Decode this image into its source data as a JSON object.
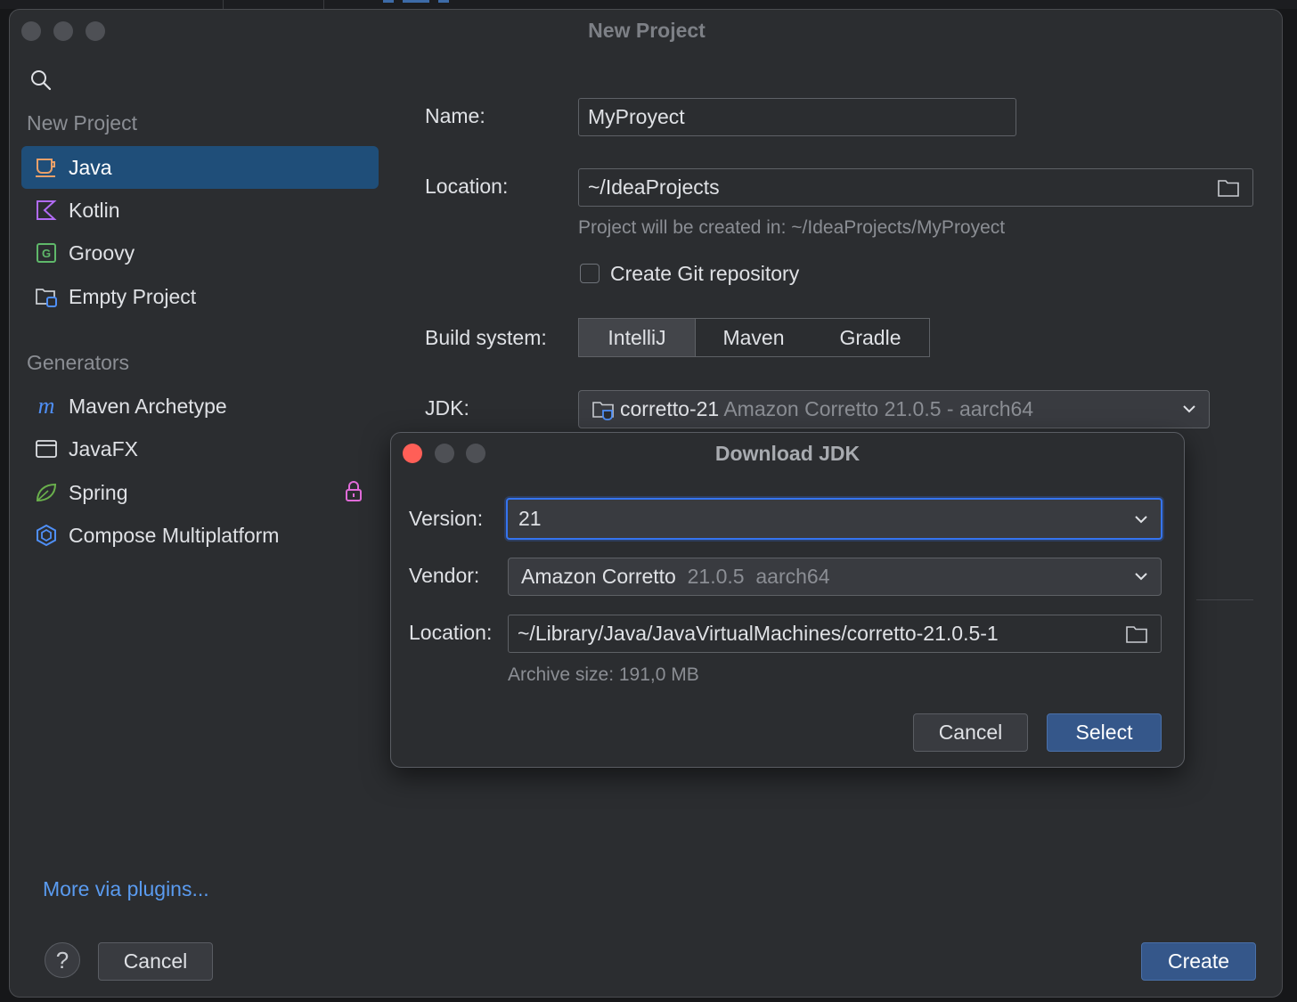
{
  "window": {
    "title": "New Project"
  },
  "sidebar": {
    "section_new": "New Project",
    "items": [
      {
        "label": "Java",
        "icon": "java-cup-icon",
        "selected": true
      },
      {
        "label": "Kotlin",
        "icon": "kotlin-icon"
      },
      {
        "label": "Groovy",
        "icon": "groovy-icon"
      },
      {
        "label": "Empty Project",
        "icon": "empty-project-folder-icon"
      }
    ],
    "section_generators": "Generators",
    "generators": [
      {
        "label": "Maven Archetype",
        "icon": "maven-m-icon"
      },
      {
        "label": "JavaFX",
        "icon": "window-icon"
      },
      {
        "label": "Spring",
        "icon": "spring-leaf-icon",
        "locked": true
      },
      {
        "label": "Compose Multiplatform",
        "icon": "compose-hexagon-icon"
      }
    ],
    "more_link": "More via plugins..."
  },
  "form": {
    "name_label": "Name:",
    "name_value": "MyProyect",
    "location_label": "Location:",
    "location_value": "~/IdeaProjects",
    "location_hint": "Project will be created in: ~/IdeaProjects/MyProyect",
    "git_label": "Create Git repository",
    "git_checked": false,
    "build_label": "Build system:",
    "build_options": [
      "IntelliJ",
      "Maven",
      "Gradle"
    ],
    "build_selected": "IntelliJ",
    "jdk_label": "JDK:",
    "jdk_name": "corretto-21",
    "jdk_detail": "Amazon Corretto 21.0.5 - aarch64"
  },
  "footer": {
    "help": "?",
    "cancel": "Cancel",
    "create": "Create"
  },
  "dialog": {
    "title": "Download JDK",
    "version_label": "Version:",
    "version_value": "21",
    "vendor_label": "Vendor:",
    "vendor_name": "Amazon Corretto",
    "vendor_version": "21.0.5",
    "vendor_arch": "aarch64",
    "location_label": "Location:",
    "location_value": "~/Library/Java/JavaVirtualMachines/corretto-21.0.5-1",
    "archive_size": "Archive size: 191,0 MB",
    "cancel": "Cancel",
    "select": "Select"
  },
  "colors": {
    "window_bg": "#2b2d30",
    "selection": "#1f4e79",
    "primary_button": "#35578a",
    "link": "#5a9bf0",
    "close_red": "#ff5f57",
    "focus_ring": "#3574f0"
  }
}
